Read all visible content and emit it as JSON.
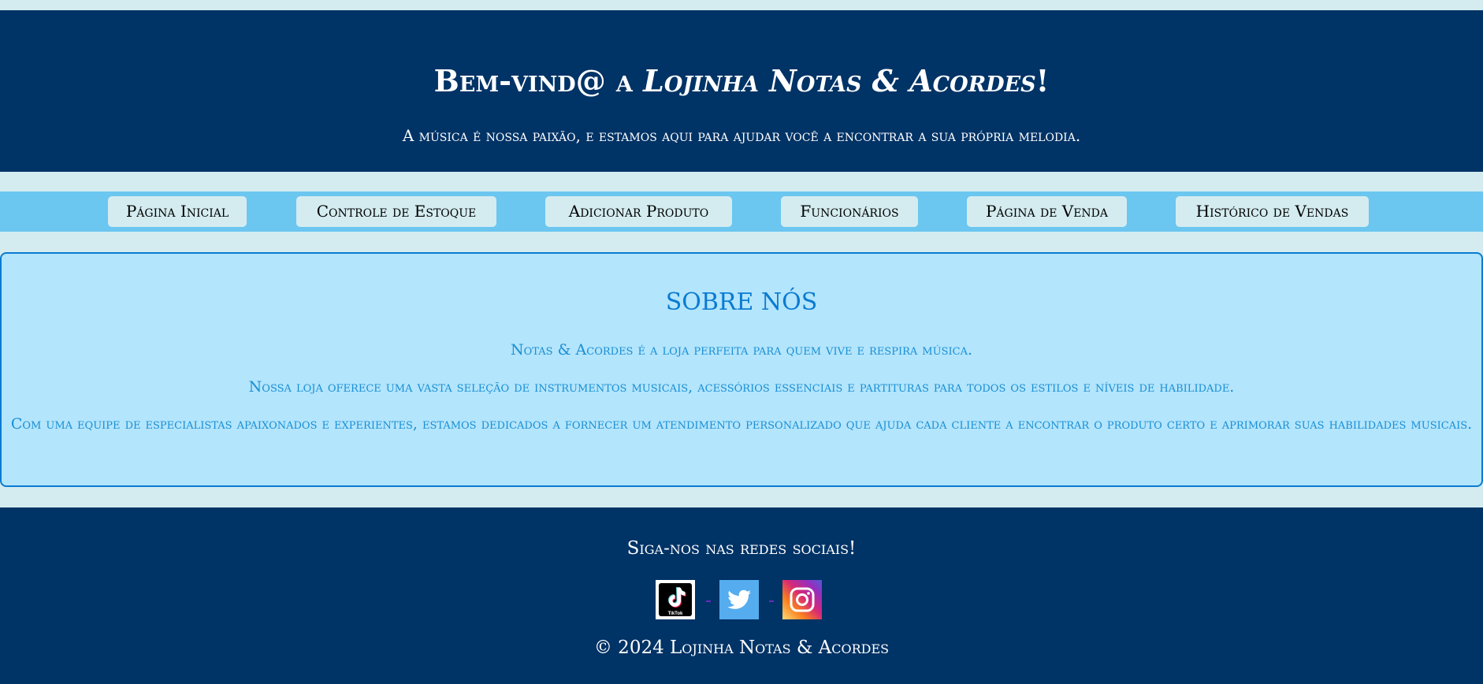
{
  "header": {
    "title_prefix": "Bem-vind@ a ",
    "title_store": "Lojinha Notas & Acordes",
    "title_suffix": "!",
    "subtitle": "A música é nossa paixão, e estamos aqui para ajudar você a encontrar a sua própria melodia."
  },
  "nav": {
    "items": [
      {
        "label": "Página Inicial"
      },
      {
        "label": "Controle de Estoque"
      },
      {
        "label": "Adicionar Produto"
      },
      {
        "label": "Funcionários"
      },
      {
        "label": "Página de Venda"
      },
      {
        "label": "Histórico de Vendas"
      }
    ]
  },
  "about": {
    "title": "SOBRE NÓS",
    "paragraphs": [
      "Notas & Acordes é a loja perfeita para quem vive e respira música.",
      "Nossa loja oferece uma vasta seleção de instrumentos musicais, acessórios essenciais e partituras para todos os estilos e níveis de habilidade.",
      "Com uma equipe de especialistas apaixonados e experientes, estamos dedicados a fornecer um atendimento personalizado que ajuda cada cliente a encontrar o produto certo e aprimorar suas habilidades musicais."
    ]
  },
  "footer": {
    "follow_text": "Siga-nos nas redes sociais!",
    "social": [
      {
        "icon": "tiktok-icon",
        "label": "TikTok"
      },
      {
        "icon": "twitter-icon"
      },
      {
        "icon": "instagram-icon"
      }
    ],
    "copyright": "© 2024 Lojinha Notas & Acordes"
  },
  "colors": {
    "header_bg": "#003366",
    "nav_bg": "#6bc6f0",
    "page_bg": "#d4ecf0",
    "about_bg": "#b3e5fc",
    "about_border": "#0a7bd1",
    "about_text": "#1a8fd4",
    "twitter": "#55acee"
  }
}
